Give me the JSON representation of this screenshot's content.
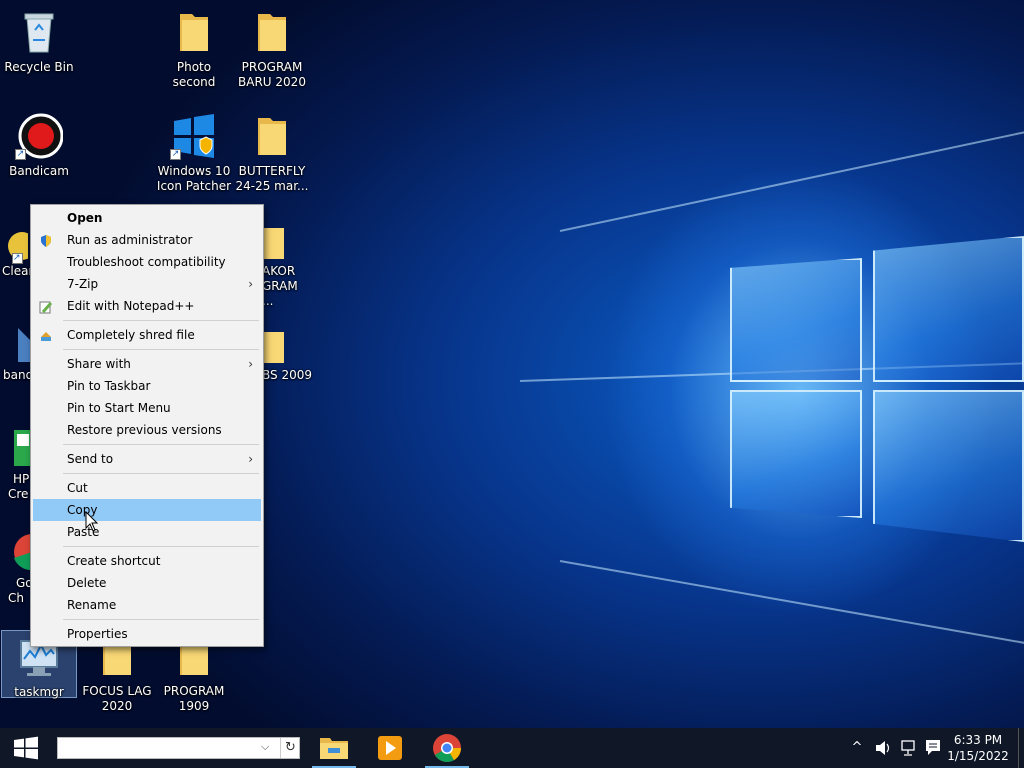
{
  "desktop": {
    "icons": [
      {
        "label": "Recycle Bin"
      },
      {
        "label": "Photo second"
      },
      {
        "label": "PROGRAM BARU 2020"
      },
      {
        "label": "Bandicam"
      },
      {
        "label": "Windows 10 Icon Patcher"
      },
      {
        "label": "BUTTERFLY 24-25 mar..."
      },
      {
        "label": "Clear"
      },
      {
        "label": "AKOR GRAM ..."
      },
      {
        "label": "band"
      },
      {
        "label": "BS 2009"
      },
      {
        "label": "HP Cre"
      },
      {
        "label": "Go Ch"
      },
      {
        "label": "taskmgr"
      },
      {
        "label": "FOCUS LAG 2020"
      },
      {
        "label": "PROGRAM 1909"
      }
    ]
  },
  "context_menu": {
    "items": [
      {
        "label": "Open"
      },
      {
        "label": "Run as administrator"
      },
      {
        "label": "Troubleshoot compatibility"
      },
      {
        "label": "7-Zip"
      },
      {
        "label": "Edit with Notepad++"
      },
      {
        "label": "Completely shred file"
      },
      {
        "label": "Share with"
      },
      {
        "label": "Pin to Taskbar"
      },
      {
        "label": "Pin to Start Menu"
      },
      {
        "label": "Restore previous versions"
      },
      {
        "label": "Send to"
      },
      {
        "label": "Cut"
      },
      {
        "label": "Copy"
      },
      {
        "label": "Paste"
      },
      {
        "label": "Create shortcut"
      },
      {
        "label": "Delete"
      },
      {
        "label": "Rename"
      },
      {
        "label": "Properties"
      }
    ],
    "submenu_arrow": "›"
  },
  "taskbar": {
    "search_value": "",
    "dropdown_glyph": "⌵",
    "refresh_glyph": "↻",
    "tray_chevron": "^",
    "clock_time": "6:33 PM",
    "clock_date": "1/15/2022"
  },
  "colors": {
    "menu_hover": "#91c9f7",
    "taskbar": "#101828",
    "folder": "#f8d775"
  }
}
